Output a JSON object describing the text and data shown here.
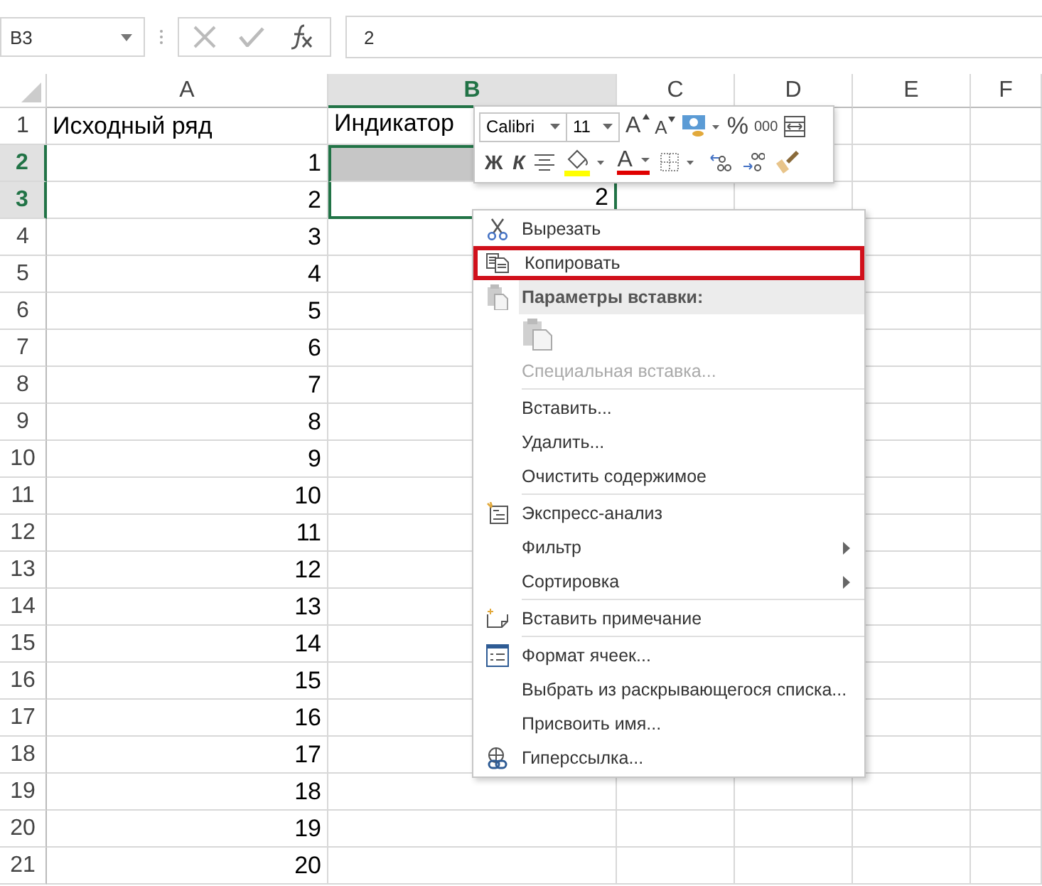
{
  "name_box": {
    "value": "B3"
  },
  "formula_bar": {
    "value": "2"
  },
  "columns": [
    {
      "label": "A",
      "selected": false
    },
    {
      "label": "B",
      "selected": true
    },
    {
      "label": "C",
      "selected": false
    },
    {
      "label": "D",
      "selected": false
    },
    {
      "label": "E",
      "selected": false
    },
    {
      "label": "F",
      "selected": false
    }
  ],
  "rows": [
    {
      "header": "1",
      "selected": false,
      "a": "Исходный ряд",
      "b": "Индикатор",
      "kind": "text"
    },
    {
      "header": "2",
      "selected": true,
      "active": false,
      "a": "1",
      "kind": "number"
    },
    {
      "header": "3",
      "selected": true,
      "active": true,
      "a": "2",
      "b": "2",
      "kind": "number"
    },
    {
      "header": "4",
      "selected": false,
      "a": "3",
      "kind": "number"
    },
    {
      "header": "5",
      "selected": false,
      "a": "4",
      "kind": "number"
    },
    {
      "header": "6",
      "selected": false,
      "a": "5",
      "kind": "number"
    },
    {
      "header": "7",
      "selected": false,
      "a": "6",
      "kind": "number"
    },
    {
      "header": "8",
      "selected": false,
      "a": "7",
      "kind": "number"
    },
    {
      "header": "9",
      "selected": false,
      "a": "8",
      "kind": "number"
    },
    {
      "header": "10",
      "selected": false,
      "a": "9",
      "kind": "number"
    },
    {
      "header": "11",
      "selected": false,
      "a": "10",
      "kind": "number"
    },
    {
      "header": "12",
      "selected": false,
      "a": "11",
      "kind": "number"
    },
    {
      "header": "13",
      "selected": false,
      "a": "12",
      "kind": "number"
    },
    {
      "header": "14",
      "selected": false,
      "a": "13",
      "kind": "number"
    },
    {
      "header": "15",
      "selected": false,
      "a": "14",
      "kind": "number"
    },
    {
      "header": "16",
      "selected": false,
      "a": "15",
      "kind": "number"
    },
    {
      "header": "17",
      "selected": false,
      "a": "16",
      "kind": "number"
    },
    {
      "header": "18",
      "selected": false,
      "a": "17",
      "kind": "number"
    },
    {
      "header": "19",
      "selected": false,
      "a": "18",
      "kind": "number"
    },
    {
      "header": "20",
      "selected": false,
      "a": "19",
      "kind": "number"
    },
    {
      "header": "21",
      "selected": false,
      "a": "20",
      "kind": "number"
    }
  ],
  "mini_toolbar": {
    "font": "Calibri",
    "size": "11",
    "row_1": [
      {
        "kind": "grow",
        "label": "A"
      },
      {
        "kind": "shrink",
        "label": "A"
      },
      {
        "kind": "accounting"
      },
      {
        "kind": "text",
        "label": "%"
      },
      {
        "kind": "small_text",
        "label": "000"
      },
      {
        "kind": "merge"
      }
    ],
    "row_2": [
      {
        "kind": "bold",
        "label": "Ж"
      },
      {
        "kind": "italic",
        "label": "К"
      },
      {
        "kind": "align"
      },
      {
        "kind": "fill"
      },
      {
        "kind": "font_color",
        "label": "A"
      },
      {
        "kind": "borders"
      },
      {
        "kind": "inc_decimal"
      },
      {
        "kind": "dec_decimal"
      },
      {
        "kind": "painter"
      }
    ]
  },
  "context_menu": [
    {
      "kind": "item",
      "label": "Вырезать",
      "highlighted": false,
      "disabled": false,
      "submenu": false
    },
    {
      "kind": "item",
      "label": "Копировать",
      "highlighted": true,
      "disabled": false,
      "submenu": false
    },
    {
      "kind": "header",
      "label": "Параметры вставки:"
    },
    {
      "kind": "paste_options"
    },
    {
      "kind": "item",
      "label": "Специальная вставка...",
      "highlighted": false,
      "disabled": true,
      "submenu": false
    },
    {
      "kind": "separator"
    },
    {
      "kind": "item",
      "label": "Вставить...",
      "highlighted": false,
      "disabled": false,
      "submenu": false
    },
    {
      "kind": "item",
      "label": "Удалить...",
      "highlighted": false,
      "disabled": false,
      "submenu": false
    },
    {
      "kind": "item",
      "label": "Очистить содержимое",
      "highlighted": false,
      "disabled": false,
      "submenu": false
    },
    {
      "kind": "separator"
    },
    {
      "kind": "item",
      "label": "Экспресс-анализ",
      "highlighted": false,
      "disabled": false,
      "submenu": false
    },
    {
      "kind": "item",
      "label": "Фильтр",
      "highlighted": false,
      "disabled": false,
      "submenu": true
    },
    {
      "kind": "item",
      "label": "Сортировка",
      "highlighted": false,
      "disabled": false,
      "submenu": true
    },
    {
      "kind": "separator"
    },
    {
      "kind": "item",
      "label": "Вставить примечание",
      "highlighted": false,
      "disabled": false,
      "submenu": false
    },
    {
      "kind": "separator"
    },
    {
      "kind": "item",
      "label": "Формат ячеек...",
      "highlighted": false,
      "disabled": false,
      "submenu": false
    },
    {
      "kind": "item",
      "label": "Выбрать из раскрывающегося списка...",
      "highlighted": false,
      "disabled": false,
      "submenu": false
    },
    {
      "kind": "item",
      "label": "Присвоить имя...",
      "highlighted": false,
      "disabled": false,
      "submenu": false
    },
    {
      "kind": "item",
      "label": "Гиперссылка...",
      "highlighted": false,
      "disabled": false,
      "submenu": false
    }
  ]
}
